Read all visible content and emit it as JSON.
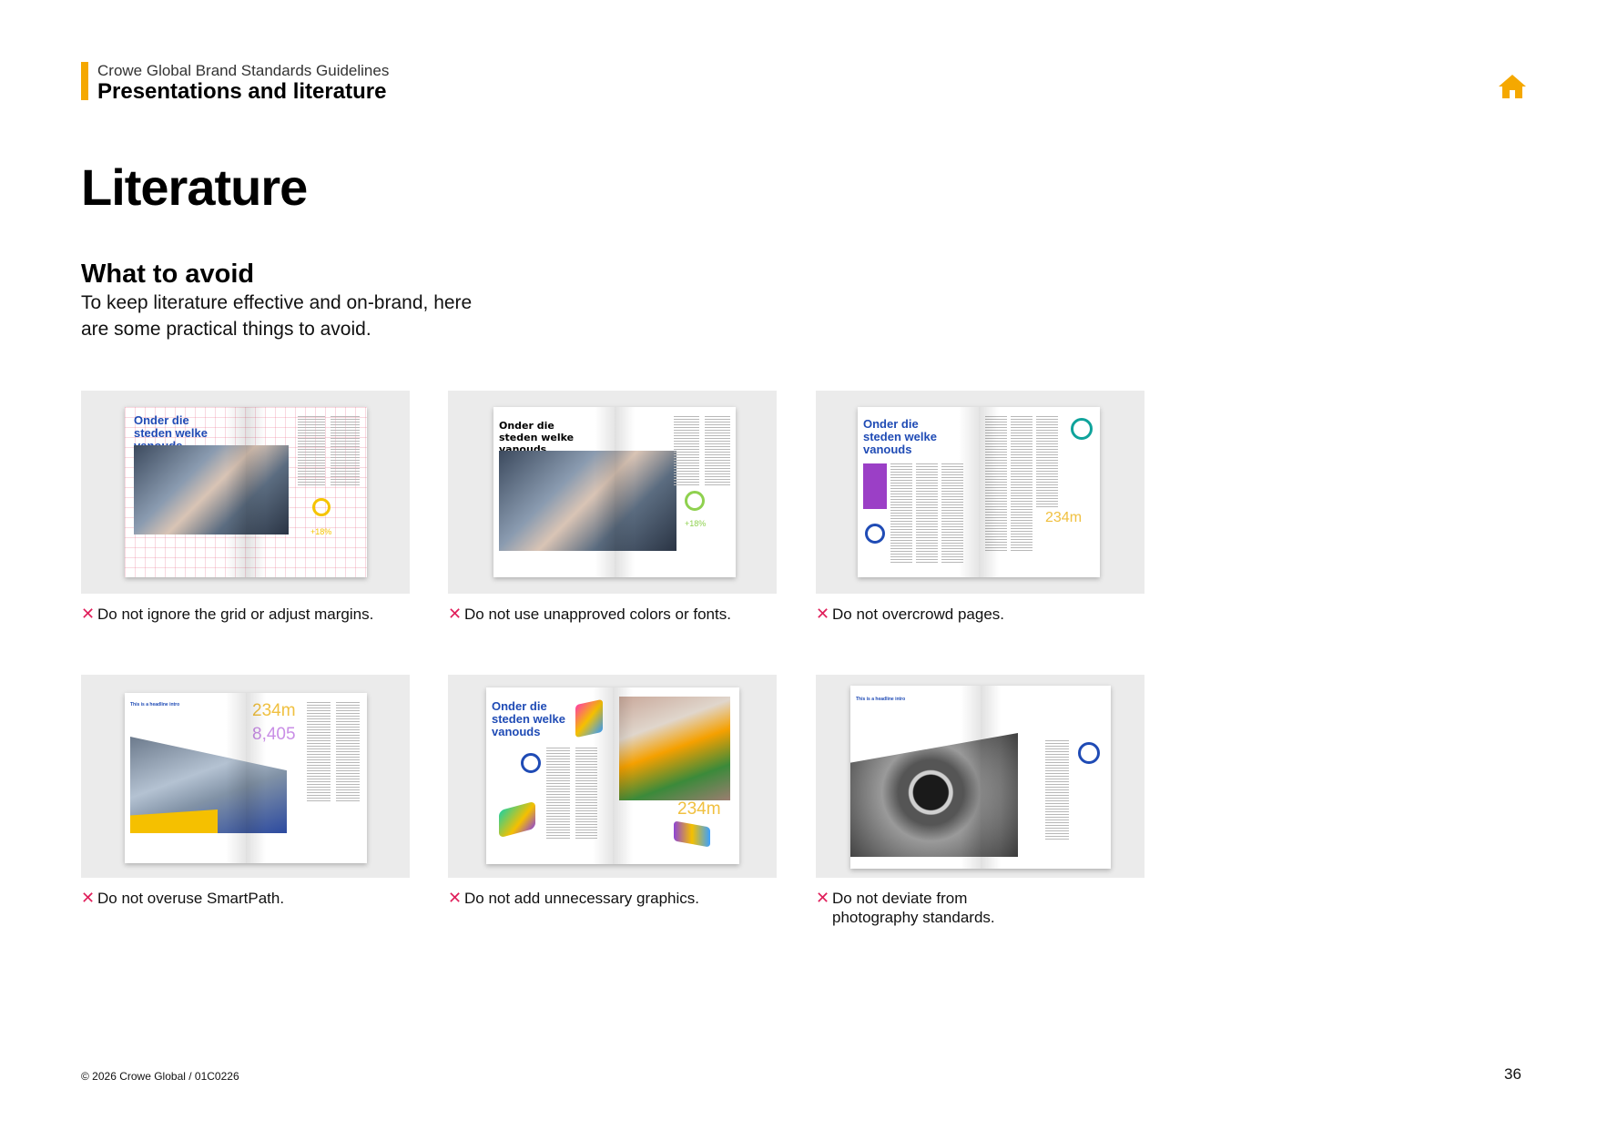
{
  "header": {
    "supertitle": "Crowe Global Brand Standards Guidelines",
    "section": "Presentations and literature"
  },
  "page": {
    "title": "Literature",
    "subheading": "What to avoid",
    "intro_line1": "To keep literature effective and on-brand, here",
    "intro_line2": "are some practical things to avoid."
  },
  "examples": [
    {
      "thumb_headline": "Onder die steden welke vanouds",
      "thumb_stat": "+18%",
      "caption": "Do not ignore the grid or adjust margins."
    },
    {
      "thumb_headline": "Onder die steden welke vanouds",
      "thumb_stat": "+18%",
      "caption": "Do not use unapproved colors or fonts."
    },
    {
      "thumb_headline": "Onder die steden welke vanouds",
      "thumb_stat": "234m",
      "caption": "Do not overcrowd pages."
    },
    {
      "thumb_headline": "This is a headline intro",
      "thumb_stat": "234m",
      "thumb_stat2": "8,405",
      "caption": "Do not overuse SmartPath."
    },
    {
      "thumb_headline": "Onder die steden welke vanouds",
      "thumb_stat": "234m",
      "caption": "Do not add unnecessary graphics."
    },
    {
      "thumb_headline": "This is a headline intro",
      "caption_line1": "Do not deviate from",
      "caption_line2": "photography standards."
    }
  ],
  "footer": {
    "copyright": "© 2026 Crowe Global  /  01C0226",
    "page_number": "36"
  },
  "colors": {
    "accent": "#f5a800",
    "avoid_mark": "#e01e5a",
    "crowe_blue": "#1f4bb5"
  },
  "icons": {
    "home": "home-icon",
    "avoid": "cross-icon"
  }
}
